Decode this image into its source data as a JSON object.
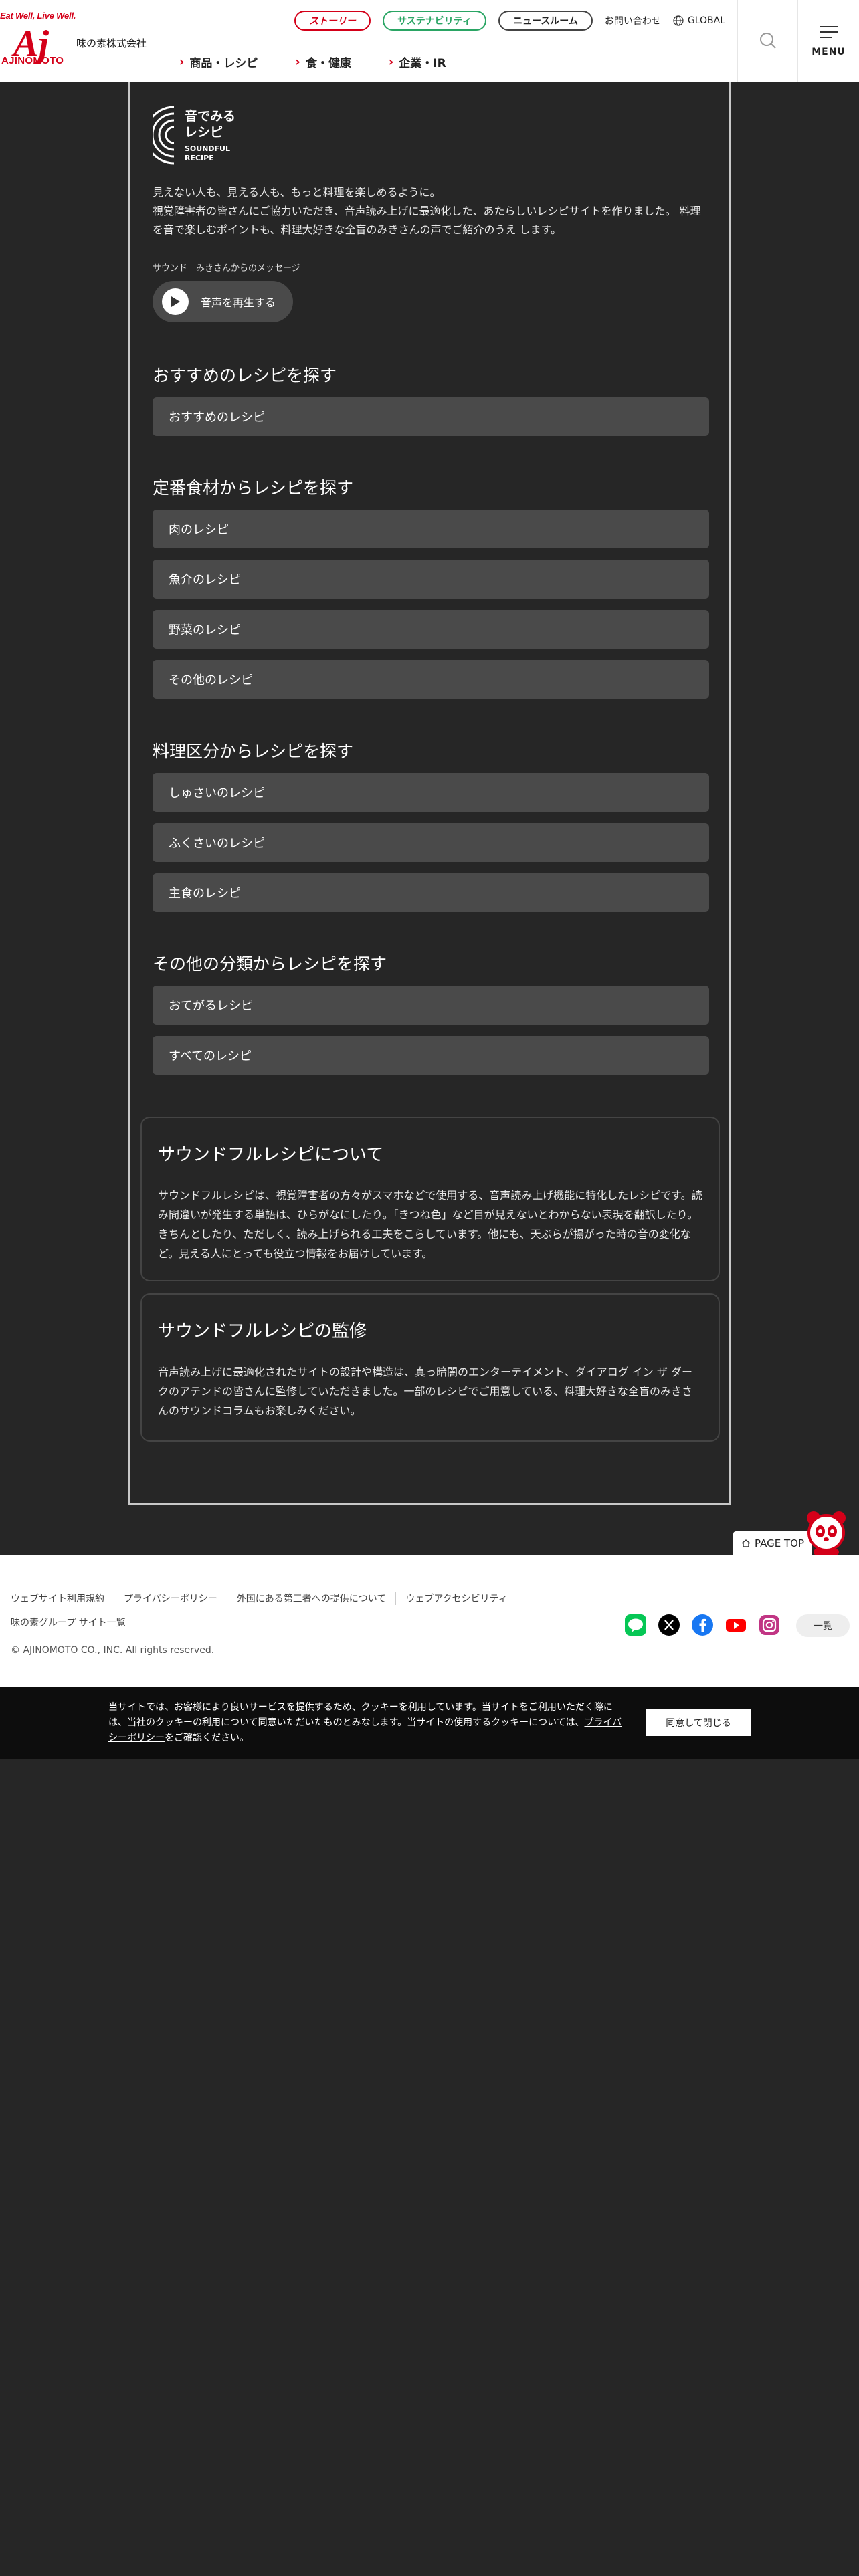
{
  "header": {
    "tagline": "Eat Well, Live Well.",
    "logo_word": "AJINOMOTO",
    "company": "味の素株式会社",
    "top_links": {
      "story": "ストーリー",
      "sustainability": "サステナビリティ",
      "news": "ニュースルーム",
      "contact": "お問い合わせ",
      "global": "GLOBAL"
    },
    "nav": [
      "商品・レシピ",
      "食・健康",
      "企業・IR"
    ],
    "menu_label": "MENU"
  },
  "logo": {
    "line1": "音でみる",
    "line2": "レシピ",
    "line3": "SOUNDFUL",
    "line4": "RECIPE"
  },
  "intro": {
    "line1": "見えない人も、見える人も、もっと料理を楽しめるように。",
    "line2": "視覚障害者の皆さんにご協力いただき、音声読み上げに最適化した、あたらしいレシピサイトを作りました。 料理を音で楽しむポイントも、料理大好きな全盲のみきさんの声でご紹介のうえ します。"
  },
  "message": {
    "label": "サウンド　みきさんからのメッセージ",
    "play": "音声を再生する"
  },
  "sections": [
    {
      "title": "おすすめのレシピを探す",
      "items": [
        "おすすめのレシピ"
      ]
    },
    {
      "title": "定番食材からレシピを探す",
      "items": [
        "肉のレシピ",
        "魚介のレシピ",
        "野菜のレシピ",
        "その他のレシピ"
      ]
    },
    {
      "title": "料理区分からレシピを探す",
      "items": [
        "しゅさいのレシピ",
        "ふくさいのレシピ",
        "主食のレシピ"
      ]
    },
    {
      "title": "その他の分類からレシピを探す",
      "items": [
        "おてがるレシピ",
        "すべてのレシピ"
      ]
    }
  ],
  "about": {
    "title": "サウンドフルレシピについて",
    "body": "サウンドフルレシピは、視覚障害者の方々がスマホなどで使用する、音声読み上げ機能に特化したレシピです。読み間違いが発生する単語は、ひらがなにしたり。「きつね色」など目が見えないとわからない表現を翻訳したり。きちんとしたり、ただしく、読み上げられる工夫をこらしています。他にも、天ぷらが揚がった時の音の変化など。見える人にとっても役立つ情報をお届けしています。"
  },
  "supervision": {
    "title": "サウンドフルレシピの監修",
    "body": "音声読み上げに最適化されたサイトの設計や構造は、真っ暗闇のエンターテイメント、ダイアログ イン ザ ダークのアテンドの皆さんに監修していただきました。一部のレシピでご用意している、料理大好きな全盲のみきさんのサウンドコラムもお楽しみください。"
  },
  "pagetop": "PAGE TOP",
  "footer": {
    "links": [
      "ウェブサイト利用規約",
      "プライバシーポリシー",
      "外国にある第三者への提供について",
      "ウェブアクセシビリティ"
    ],
    "sitemap": "味の素グループ サイト一覧",
    "copyright": "© AJINOMOTO CO., INC. All rights reserved.",
    "list_button": "一覧",
    "social": [
      "line-icon",
      "x-icon",
      "facebook-icon",
      "youtube-icon",
      "instagram-icon"
    ]
  },
  "cookie": {
    "text_before": "当サイトでは、お客様により良いサービスを提供するため、クッキーを利用しています。当サイトをご利用いただく際には、当社のクッキーの利用について同意いただいたものとみなします。当サイトの使用するクッキーについては、",
    "link": "プライバシーポリシー",
    "text_after": "をご確認ください。",
    "button": "同意して閉じる"
  }
}
